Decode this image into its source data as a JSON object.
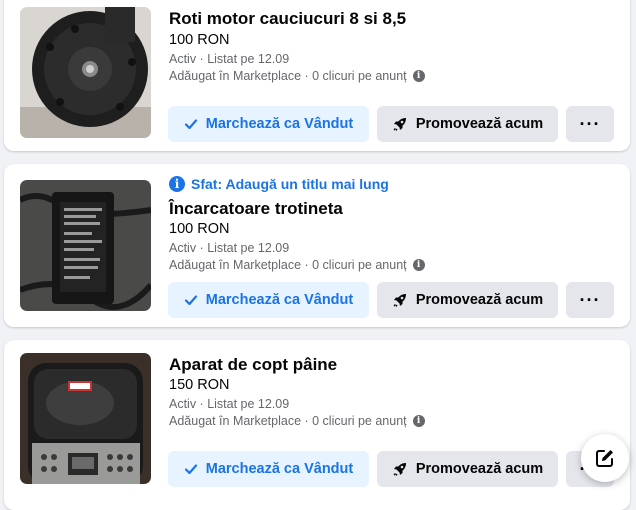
{
  "listings": [
    {
      "title": "Roti motor cauciucuri 8 si 8,5",
      "price": "100 RON",
      "status": "Activ · Listat pe 12.09",
      "stats": "Adăugat în Marketplace · 0 clicuri pe anunț",
      "sold_label": "Marchează ca Vândut",
      "promote_label": "Promovează acum",
      "more_label": "···"
    },
    {
      "tip": "Sfat: Adaugă un titlu mai lung",
      "title": "Încarcatoare trotineta",
      "price": "100 RON",
      "status": "Activ · Listat pe 12.09",
      "stats": "Adăugat în Marketplace · 0 clicuri pe anunț",
      "sold_label": "Marchează ca Vândut",
      "promote_label": "Promovează acum",
      "more_label": "···"
    },
    {
      "title": "Aparat de copt pâine",
      "price": "150 RON",
      "status": "Activ · Listat pe 12.09",
      "stats": "Adăugat în Marketplace · 0 clicuri pe anunț",
      "sold_label": "Marchează ca Vândut",
      "promote_label": "Promovează acum",
      "more_label": "···"
    }
  ],
  "icons": {
    "check": "check-icon",
    "rocket": "rocket-icon",
    "info": "info-icon",
    "compose": "compose-icon"
  },
  "colors": {
    "accent": "#1b74e4",
    "sold_bg": "#e7f3ff",
    "secondary_bg": "#e4e6eb",
    "muted_text": "#65676b",
    "page_bg": "#f0f2f5"
  }
}
